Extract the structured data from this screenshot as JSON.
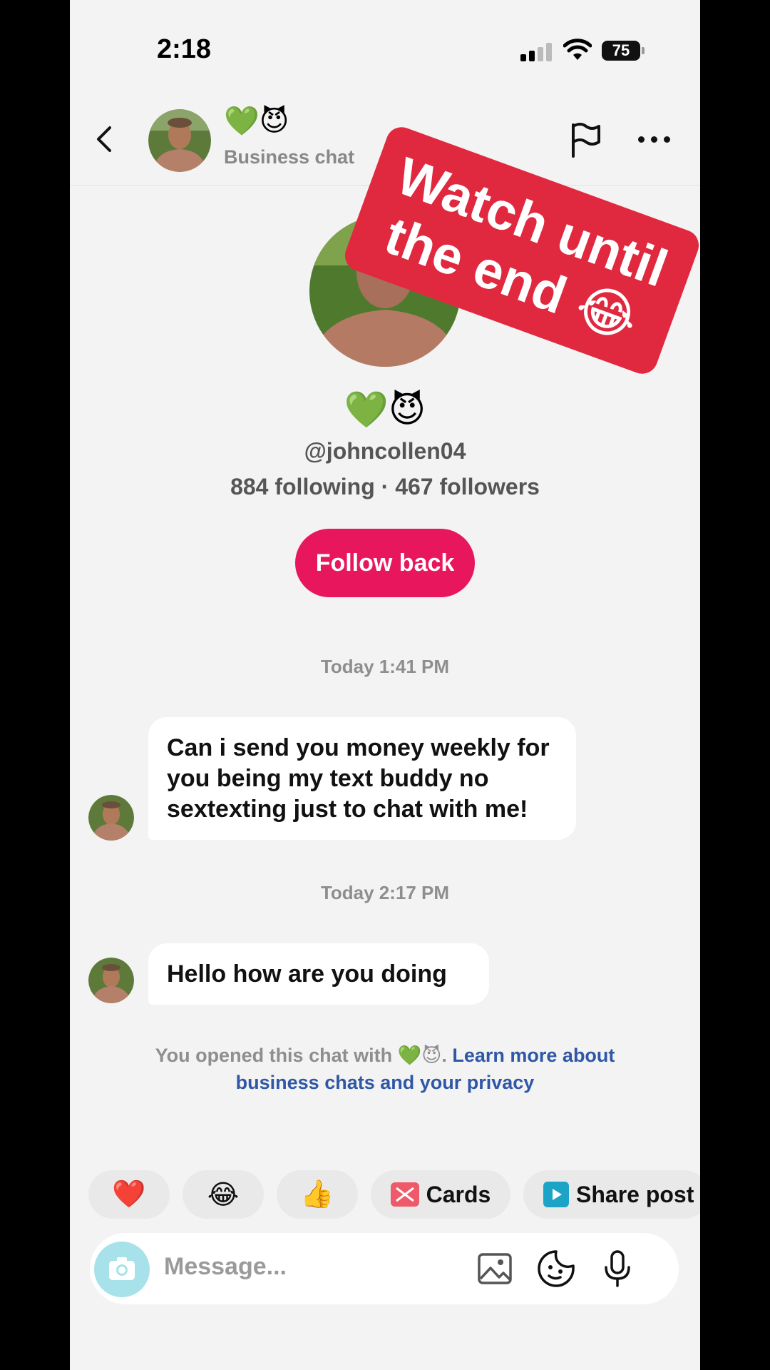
{
  "status": {
    "time": "2:18",
    "battery": "75"
  },
  "header": {
    "emoji": "💚😈",
    "subtitle": "Business chat"
  },
  "sticker": {
    "line1": "Watch until",
    "line2": "the end 😂"
  },
  "profile": {
    "emoji": "💚😈",
    "handle": "@johncollen04",
    "stats": "884 following · 467 followers",
    "follow_label": "Follow back"
  },
  "messages": [
    {
      "timestamp": "Today 1:41 PM",
      "text": "Can i send you money weekly for you being my text buddy no sextexting just to chat with me!"
    },
    {
      "timestamp": "Today 2:17 PM",
      "text": "Hello how are you doing"
    }
  ],
  "notice": {
    "prefix": "You opened this chat with 💚😈.",
    "link": "Learn more about business chats and your privacy"
  },
  "quick_replies": [
    {
      "emoji": "❤️"
    },
    {
      "emoji": "😂"
    },
    {
      "emoji": "👍"
    },
    {
      "label": "Cards"
    },
    {
      "label": "Share post"
    }
  ],
  "composer": {
    "placeholder": "Message..."
  },
  "colors": {
    "accent": "#e8175d",
    "sticker": "#e0283f",
    "link": "#2f57a6"
  }
}
